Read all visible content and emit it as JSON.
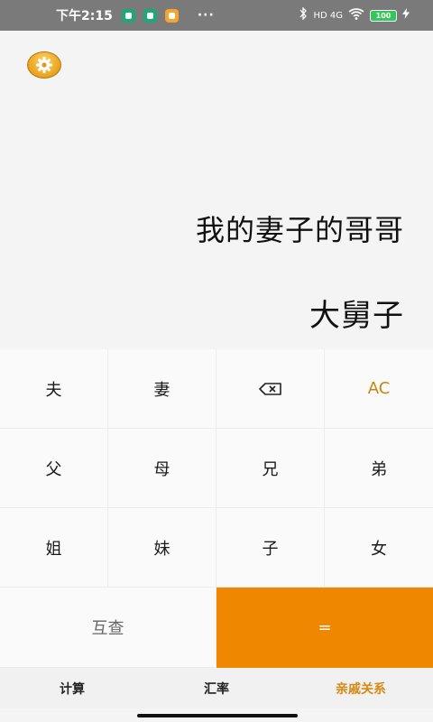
{
  "status_bar": {
    "time": "下午2:15",
    "more": "···",
    "network": "HD 4G",
    "battery": "100"
  },
  "display": {
    "expression": "我的妻子的哥哥",
    "result": "大舅子"
  },
  "keypad": {
    "rows": [
      [
        "夫",
        "妻",
        "",
        "AC"
      ],
      [
        "父",
        "母",
        "兄",
        "弟"
      ],
      [
        "姐",
        "妹",
        "子",
        "女"
      ]
    ],
    "mutual_label": "互查",
    "equals_label": "="
  },
  "tabs": [
    {
      "label": "计算"
    },
    {
      "label": "汇率"
    },
    {
      "label": "亲戚关系"
    }
  ],
  "colors": {
    "accent": "#ef8800",
    "accent_text": "#d48b15",
    "status_bar": "#7a7a7a"
  }
}
